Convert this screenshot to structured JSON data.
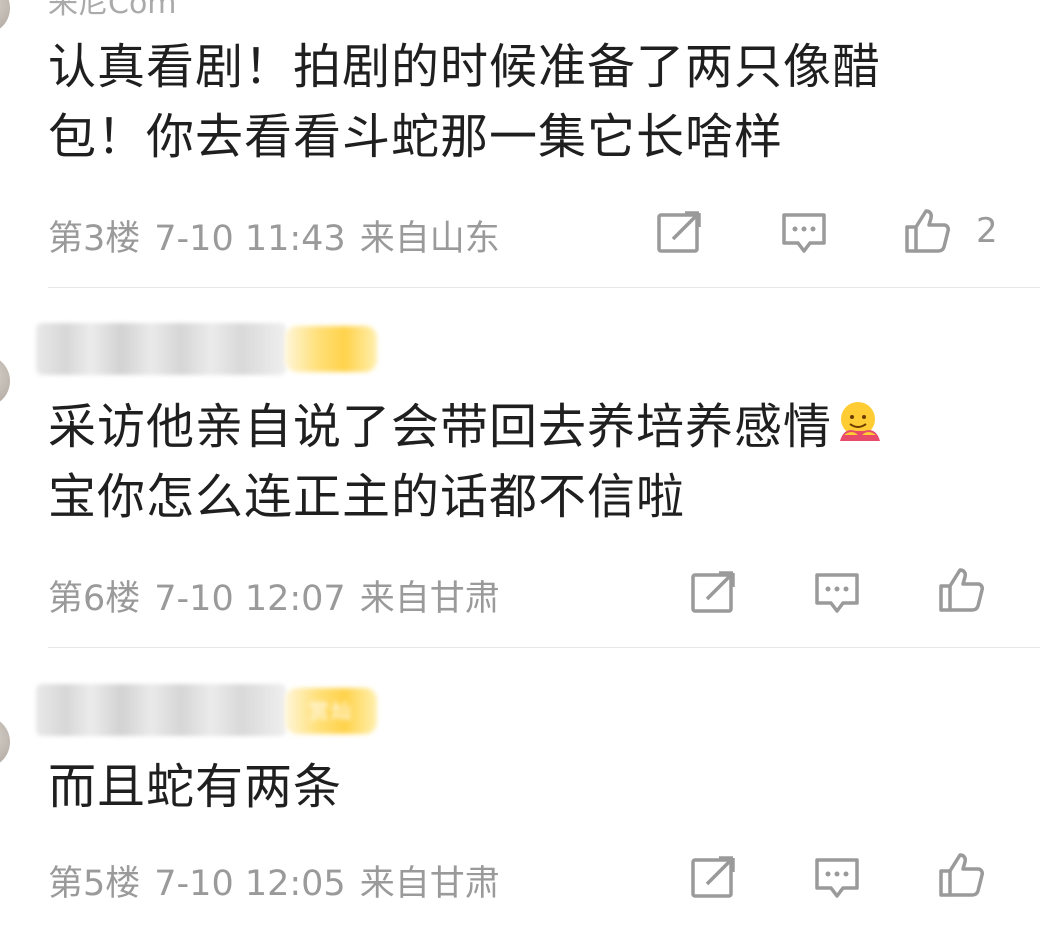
{
  "comments": [
    {
      "content_lines": [
        "认真看剧！拍剧的时候准备了两只像醋",
        "包！你去看看斗蛇那一集它长啥样"
      ],
      "floor": "第3楼",
      "time": "7-10 11:43",
      "location": "来自山东",
      "likes": "2"
    },
    {
      "content_lines": [
        "采访他亲自说了会带回去养培养感情",
        "宝你怎么连正主的话都不信啦"
      ],
      "emoji": "hug-emoji",
      "floor": "第6楼",
      "time": "7-10 12:07",
      "location": "来自甘肃",
      "likes": ""
    },
    {
      "content_lines": [
        "而且蛇有两条"
      ],
      "badge": "赏灿",
      "floor": "第5楼",
      "time": "7-10 12:05",
      "location": "来自甘肃",
      "likes": ""
    }
  ],
  "top_partial_text": "来尼Com",
  "colors": {
    "text": "#1f1f1f",
    "meta": "#9a9a9a",
    "divider": "#e6e6e6",
    "badge": "#ffd24a"
  }
}
